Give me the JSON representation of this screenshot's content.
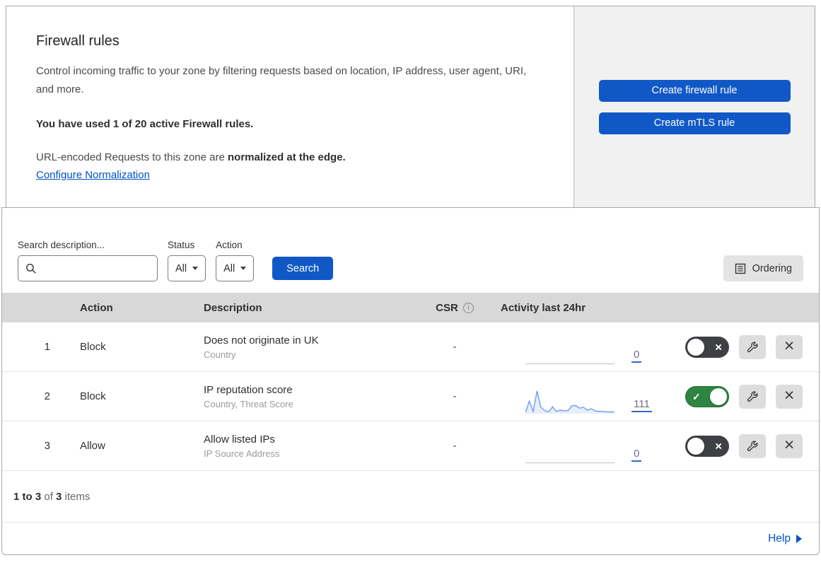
{
  "header": {
    "title": "Firewall rules",
    "description": "Control incoming traffic to your zone by filtering requests based on location, IP address, user agent, URI, and more.",
    "usage_text": "You have used 1 of 20 active Firewall rules.",
    "normalization_prefix": "URL-encoded Requests to this zone are ",
    "normalization_bold": "normalized at the edge.",
    "normalization_link": "Configure Normalization",
    "buttons": [
      {
        "label": "Create firewall rule"
      },
      {
        "label": "Create mTLS rule"
      }
    ]
  },
  "filters": {
    "search_label": "Search description...",
    "search_value": "",
    "status_label": "Status",
    "status_value": "All",
    "action_label": "Action",
    "action_value": "All",
    "search_button_label": "Search",
    "ordering_button_label": "Ordering"
  },
  "table": {
    "columns": {
      "action": "Action",
      "description": "Description",
      "csr": "CSR",
      "activity": "Activity last 24hr"
    },
    "rows": [
      {
        "number": "1",
        "action": "Block",
        "description": "Does not originate in UK",
        "fields": "Country",
        "csr": "-",
        "activity_count": "0",
        "enabled": false,
        "sparkline": []
      },
      {
        "number": "2",
        "action": "Block",
        "description": "IP reputation score",
        "fields": "Country, Threat Score",
        "csr": "-",
        "activity_count": "111",
        "enabled": true,
        "sparkline": [
          0.06,
          0.55,
          0.1,
          1.0,
          0.28,
          0.13,
          0.08,
          0.3,
          0.1,
          0.16,
          0.12,
          0.14,
          0.34,
          0.36,
          0.24,
          0.28,
          0.15,
          0.22,
          0.12,
          0.1,
          0.1,
          0.08,
          0.08,
          0.07
        ]
      },
      {
        "number": "3",
        "action": "Allow",
        "description": "Allow listed IPs",
        "fields": "IP Source Address",
        "csr": "-",
        "activity_count": "0",
        "enabled": false,
        "sparkline": []
      }
    ]
  },
  "footer": {
    "range_text": "1 to 3",
    "of_text": " of ",
    "total_text": "3",
    "items_text": " items"
  },
  "help": {
    "label": "Help"
  },
  "icons": {
    "check": "✓",
    "close": "×",
    "info": "i",
    "delete": "×"
  },
  "colors": {
    "primary_blue": "#1158c7",
    "link_blue": "#0051c3",
    "toggle_green": "#2e8540",
    "toggle_dark": "#3f4044",
    "table_header_gray": "#d8d8d8",
    "panel_gray": "#f1f1f1",
    "sparkline_blue": "#6d9ef0",
    "sparkline_fill": "#e7eefb"
  }
}
